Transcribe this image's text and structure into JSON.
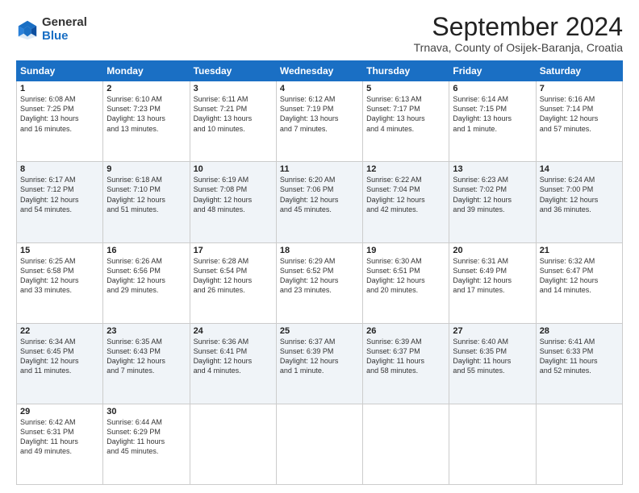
{
  "header": {
    "logo_general": "General",
    "logo_blue": "Blue",
    "month_title": "September 2024",
    "location": "Trnava, County of Osijek-Baranja, Croatia"
  },
  "days_of_week": [
    "Sunday",
    "Monday",
    "Tuesday",
    "Wednesday",
    "Thursday",
    "Friday",
    "Saturday"
  ],
  "weeks": [
    [
      {
        "day": "1",
        "lines": [
          "Sunrise: 6:08 AM",
          "Sunset: 7:25 PM",
          "Daylight: 13 hours",
          "and 16 minutes."
        ]
      },
      {
        "day": "2",
        "lines": [
          "Sunrise: 6:10 AM",
          "Sunset: 7:23 PM",
          "Daylight: 13 hours",
          "and 13 minutes."
        ]
      },
      {
        "day": "3",
        "lines": [
          "Sunrise: 6:11 AM",
          "Sunset: 7:21 PM",
          "Daylight: 13 hours",
          "and 10 minutes."
        ]
      },
      {
        "day": "4",
        "lines": [
          "Sunrise: 6:12 AM",
          "Sunset: 7:19 PM",
          "Daylight: 13 hours",
          "and 7 minutes."
        ]
      },
      {
        "day": "5",
        "lines": [
          "Sunrise: 6:13 AM",
          "Sunset: 7:17 PM",
          "Daylight: 13 hours",
          "and 4 minutes."
        ]
      },
      {
        "day": "6",
        "lines": [
          "Sunrise: 6:14 AM",
          "Sunset: 7:15 PM",
          "Daylight: 13 hours",
          "and 1 minute."
        ]
      },
      {
        "day": "7",
        "lines": [
          "Sunrise: 6:16 AM",
          "Sunset: 7:14 PM",
          "Daylight: 12 hours",
          "and 57 minutes."
        ]
      }
    ],
    [
      {
        "day": "8",
        "lines": [
          "Sunrise: 6:17 AM",
          "Sunset: 7:12 PM",
          "Daylight: 12 hours",
          "and 54 minutes."
        ]
      },
      {
        "day": "9",
        "lines": [
          "Sunrise: 6:18 AM",
          "Sunset: 7:10 PM",
          "Daylight: 12 hours",
          "and 51 minutes."
        ]
      },
      {
        "day": "10",
        "lines": [
          "Sunrise: 6:19 AM",
          "Sunset: 7:08 PM",
          "Daylight: 12 hours",
          "and 48 minutes."
        ]
      },
      {
        "day": "11",
        "lines": [
          "Sunrise: 6:20 AM",
          "Sunset: 7:06 PM",
          "Daylight: 12 hours",
          "and 45 minutes."
        ]
      },
      {
        "day": "12",
        "lines": [
          "Sunrise: 6:22 AM",
          "Sunset: 7:04 PM",
          "Daylight: 12 hours",
          "and 42 minutes."
        ]
      },
      {
        "day": "13",
        "lines": [
          "Sunrise: 6:23 AM",
          "Sunset: 7:02 PM",
          "Daylight: 12 hours",
          "and 39 minutes."
        ]
      },
      {
        "day": "14",
        "lines": [
          "Sunrise: 6:24 AM",
          "Sunset: 7:00 PM",
          "Daylight: 12 hours",
          "and 36 minutes."
        ]
      }
    ],
    [
      {
        "day": "15",
        "lines": [
          "Sunrise: 6:25 AM",
          "Sunset: 6:58 PM",
          "Daylight: 12 hours",
          "and 33 minutes."
        ]
      },
      {
        "day": "16",
        "lines": [
          "Sunrise: 6:26 AM",
          "Sunset: 6:56 PM",
          "Daylight: 12 hours",
          "and 29 minutes."
        ]
      },
      {
        "day": "17",
        "lines": [
          "Sunrise: 6:28 AM",
          "Sunset: 6:54 PM",
          "Daylight: 12 hours",
          "and 26 minutes."
        ]
      },
      {
        "day": "18",
        "lines": [
          "Sunrise: 6:29 AM",
          "Sunset: 6:52 PM",
          "Daylight: 12 hours",
          "and 23 minutes."
        ]
      },
      {
        "day": "19",
        "lines": [
          "Sunrise: 6:30 AM",
          "Sunset: 6:51 PM",
          "Daylight: 12 hours",
          "and 20 minutes."
        ]
      },
      {
        "day": "20",
        "lines": [
          "Sunrise: 6:31 AM",
          "Sunset: 6:49 PM",
          "Daylight: 12 hours",
          "and 17 minutes."
        ]
      },
      {
        "day": "21",
        "lines": [
          "Sunrise: 6:32 AM",
          "Sunset: 6:47 PM",
          "Daylight: 12 hours",
          "and 14 minutes."
        ]
      }
    ],
    [
      {
        "day": "22",
        "lines": [
          "Sunrise: 6:34 AM",
          "Sunset: 6:45 PM",
          "Daylight: 12 hours",
          "and 11 minutes."
        ]
      },
      {
        "day": "23",
        "lines": [
          "Sunrise: 6:35 AM",
          "Sunset: 6:43 PM",
          "Daylight: 12 hours",
          "and 7 minutes."
        ]
      },
      {
        "day": "24",
        "lines": [
          "Sunrise: 6:36 AM",
          "Sunset: 6:41 PM",
          "Daylight: 12 hours",
          "and 4 minutes."
        ]
      },
      {
        "day": "25",
        "lines": [
          "Sunrise: 6:37 AM",
          "Sunset: 6:39 PM",
          "Daylight: 12 hours",
          "and 1 minute."
        ]
      },
      {
        "day": "26",
        "lines": [
          "Sunrise: 6:39 AM",
          "Sunset: 6:37 PM",
          "Daylight: 11 hours",
          "and 58 minutes."
        ]
      },
      {
        "day": "27",
        "lines": [
          "Sunrise: 6:40 AM",
          "Sunset: 6:35 PM",
          "Daylight: 11 hours",
          "and 55 minutes."
        ]
      },
      {
        "day": "28",
        "lines": [
          "Sunrise: 6:41 AM",
          "Sunset: 6:33 PM",
          "Daylight: 11 hours",
          "and 52 minutes."
        ]
      }
    ],
    [
      {
        "day": "29",
        "lines": [
          "Sunrise: 6:42 AM",
          "Sunset: 6:31 PM",
          "Daylight: 11 hours",
          "and 49 minutes."
        ]
      },
      {
        "day": "30",
        "lines": [
          "Sunrise: 6:44 AM",
          "Sunset: 6:29 PM",
          "Daylight: 11 hours",
          "and 45 minutes."
        ]
      },
      {
        "day": "",
        "lines": []
      },
      {
        "day": "",
        "lines": []
      },
      {
        "day": "",
        "lines": []
      },
      {
        "day": "",
        "lines": []
      },
      {
        "day": "",
        "lines": []
      }
    ]
  ]
}
